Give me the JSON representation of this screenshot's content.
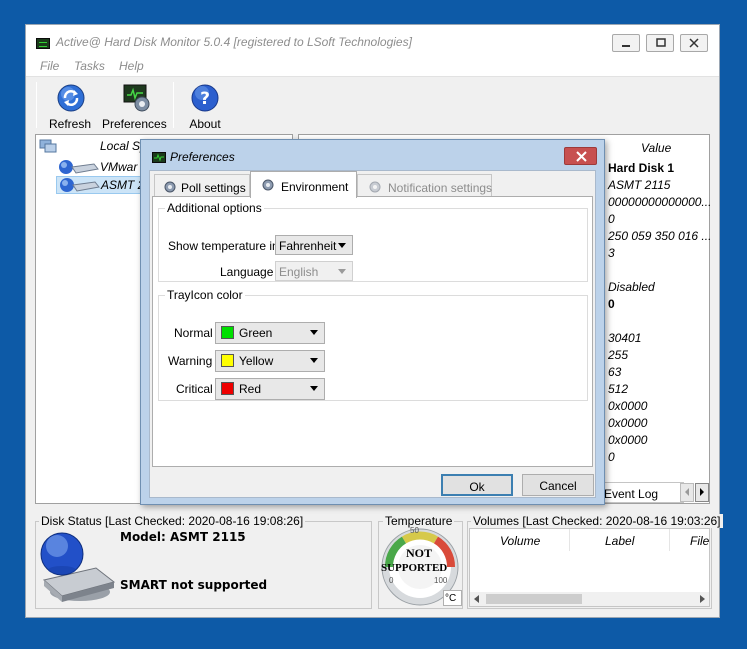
{
  "app": {
    "title": "Active@ Hard Disk Monitor 5.0.4 [registered to LSoft Technologies]"
  },
  "menu": [
    "File",
    "Tasks",
    "Help"
  ],
  "toolbar": {
    "refresh_label": "Refresh",
    "preferences_label": "Preferences",
    "about_label": "About"
  },
  "tree": {
    "root_label": "Local Sy",
    "items": [
      "VMwar",
      "ASMT 2"
    ]
  },
  "details": {
    "value_header": "Value",
    "values": [
      "Hard Disk 1",
      "ASMT 2115",
      "00000000000000...",
      "0",
      "250 059 350 016 ...",
      "3",
      "",
      "Disabled",
      "0",
      "",
      "30401",
      "255",
      "63",
      "512",
      "0x0000",
      "0x0000",
      "0x0000",
      "0"
    ],
    "event_log_tab": "Event Log"
  },
  "disk_status": {
    "title": "Disk Status [Last Checked: 2020-08-16 19:08:26]",
    "model": "Model: ASMT 2115",
    "smart": "SMART not supported"
  },
  "temperature": {
    "title": "Temperature",
    "line1": "NOT",
    "line2": "SUPPORTED",
    "unit": "°C",
    "tick_50": "50",
    "tick_0": "0",
    "tick_100": "100"
  },
  "volumes": {
    "title": "Volumes [Last Checked: 2020-08-16 19:03:26]",
    "columns": [
      "Volume",
      "Label",
      "File"
    ]
  },
  "preferences": {
    "title": "Preferences",
    "tabs": [
      "Poll settings",
      "Environment",
      "Notification settings"
    ],
    "active_tab": "Environment",
    "additional_options": {
      "title": "Additional options",
      "show_temp_label": "Show temperature in",
      "show_temp_value": "Fahrenheit",
      "language_label": "Language",
      "language_value": "English"
    },
    "trayicon": {
      "title": "TrayIcon color",
      "rows": [
        {
          "label": "Normal",
          "value": "Green",
          "color": "#00e000"
        },
        {
          "label": "Warning",
          "value": "Yellow",
          "color": "#ffff00"
        },
        {
          "label": "Critical",
          "value": "Red",
          "color": "#ee0000"
        }
      ]
    },
    "ok_label": "Ok",
    "cancel_label": "Cancel"
  },
  "colors": {
    "desktop": "#0d5aa7",
    "dialog_frame": "#bcd2ea",
    "close_button": "#c75050",
    "default_button_border": "#3c7fb1"
  }
}
